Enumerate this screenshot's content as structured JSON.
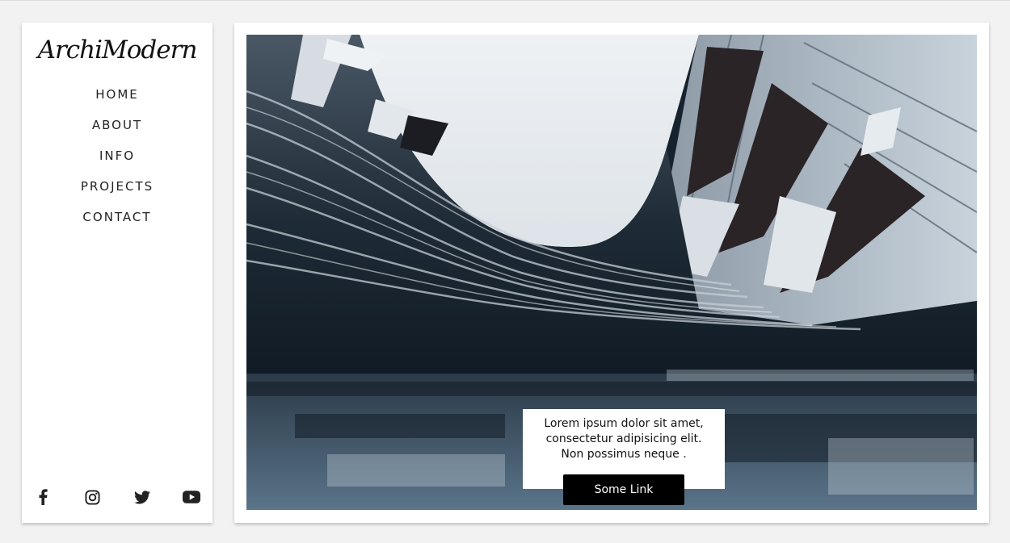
{
  "brand": {
    "logo_text": "ArchiModern"
  },
  "nav": {
    "items": [
      {
        "label": "HOME"
      },
      {
        "label": "ABOUT"
      },
      {
        "label": "INFO"
      },
      {
        "label": "PROJECTS"
      },
      {
        "label": "CONTACT"
      }
    ]
  },
  "social": {
    "icons": [
      "facebook-icon",
      "instagram-icon",
      "twitter-icon",
      "youtube-icon"
    ],
    "color": "#222222"
  },
  "hero": {
    "image_subject": "curved modern building facade seen from below, dark blue-grey tones",
    "caption": {
      "line1": "Lorem ipsum dolor sit amet,",
      "line2": "consectetur adipisicing elit.",
      "line3": "Non possimus neque .",
      "button_label": "Some Link"
    }
  },
  "colors": {
    "page_bg": "#f2f2f2",
    "panel_bg": "#ffffff",
    "text": "#222222",
    "button_bg": "#000000",
    "button_text": "#ffffff"
  }
}
